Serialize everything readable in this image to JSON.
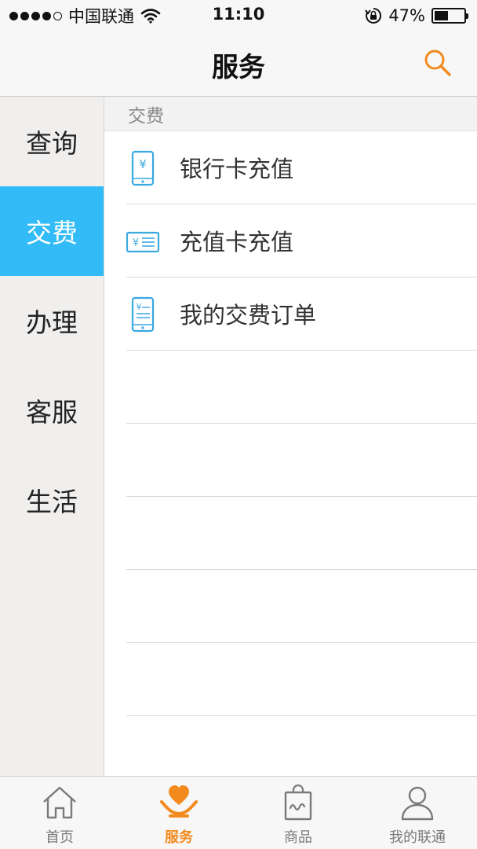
{
  "status_bar": {
    "carrier": "中国联通",
    "time": "11:10",
    "battery_percent_text": "47%",
    "battery_level": 0.47,
    "signal_bars_filled": 4,
    "signal_bars_total": 5
  },
  "nav": {
    "title": "服务",
    "search_icon": "search-icon"
  },
  "sidebar": {
    "items": [
      {
        "label": "查询",
        "active": false
      },
      {
        "label": "交费",
        "active": true
      },
      {
        "label": "办理",
        "active": false
      },
      {
        "label": "客服",
        "active": false
      },
      {
        "label": "生活",
        "active": false
      }
    ]
  },
  "content": {
    "section_title": "交费",
    "items": [
      {
        "label": "银行卡充值",
        "icon": "phone-yuan-icon"
      },
      {
        "label": "充值卡充值",
        "icon": "recharge-card-icon"
      },
      {
        "label": "我的交费订单",
        "icon": "phone-bill-icon"
      }
    ]
  },
  "tab_bar": {
    "tabs": [
      {
        "label": "首页",
        "icon": "home-icon",
        "active": false
      },
      {
        "label": "服务",
        "icon": "heart-hands-icon",
        "active": true
      },
      {
        "label": "商品",
        "icon": "shopping-bag-icon",
        "active": false
      },
      {
        "label": "我的联通",
        "icon": "user-icon",
        "active": false
      }
    ]
  },
  "colors": {
    "accent_blue": "#32bbf6",
    "accent_orange": "#f28a1e",
    "icon_blue": "#3aa9e0"
  }
}
